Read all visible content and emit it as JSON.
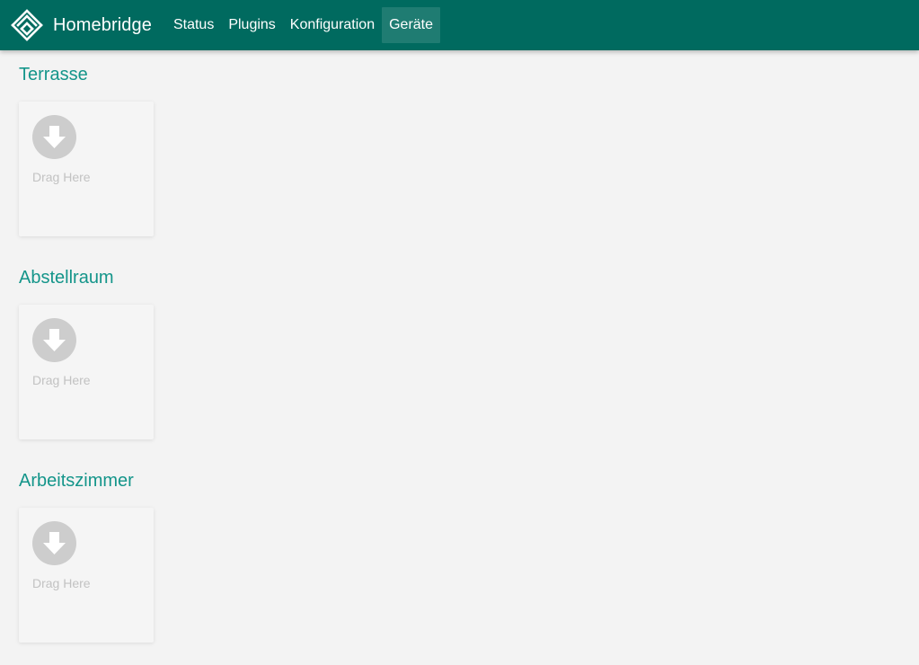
{
  "app": {
    "brand": "Homebridge",
    "logo_icon": "homebridge-logo-icon",
    "header_color": "#006a5f",
    "accent_color": "#14958a"
  },
  "nav": {
    "items": [
      {
        "label": "Status",
        "active": false
      },
      {
        "label": "Plugins",
        "active": false
      },
      {
        "label": "Konfiguration",
        "active": false
      },
      {
        "label": "Geräte",
        "active": true
      }
    ]
  },
  "rooms": [
    {
      "name": "Terrasse",
      "drop_label": "Drag Here",
      "drop_icon": "arrow-down-circle-icon"
    },
    {
      "name": "Abstellraum",
      "drop_label": "Drag Here",
      "drop_icon": "arrow-down-circle-icon"
    },
    {
      "name": "Arbeitszimmer",
      "drop_label": "Drag Here",
      "drop_icon": "arrow-down-circle-icon"
    }
  ]
}
